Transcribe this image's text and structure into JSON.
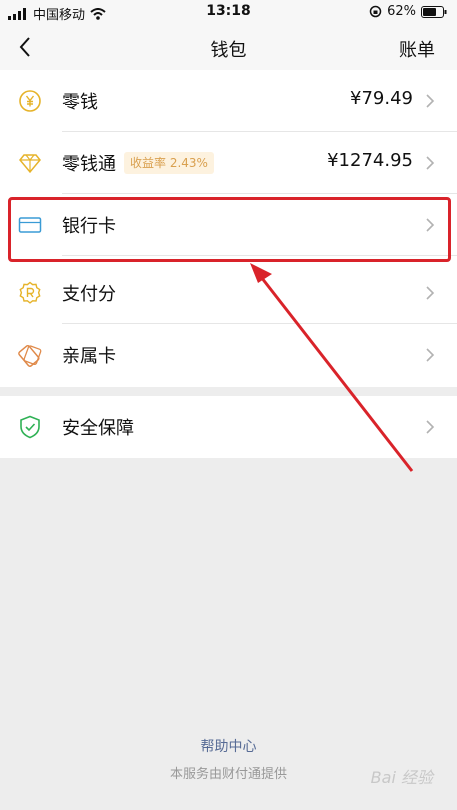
{
  "status_bar": {
    "carrier": "中国移动",
    "time": "13:18",
    "battery": "62%"
  },
  "nav": {
    "title": "钱包",
    "action": "账单"
  },
  "wallet_items": [
    {
      "label": "零钱",
      "value": "¥79.49",
      "icon": "coin-icon",
      "color": "#e6b32a"
    },
    {
      "label": "零钱通",
      "badge": "收益率 2.43%",
      "value": "¥1274.95",
      "icon": "diamond-icon",
      "color": "#e6b32a"
    },
    {
      "label": "银行卡",
      "icon": "bank-card-icon",
      "color": "#3a9bd5"
    },
    {
      "label": "支付分",
      "icon": "credit-score-icon",
      "color": "#e6b32a"
    },
    {
      "label": "亲属卡",
      "icon": "family-card-icon",
      "color": "#e08a4a"
    }
  ],
  "security": {
    "label": "安全保障",
    "icon": "shield-icon",
    "color": "#2fb155"
  },
  "footer": {
    "help_link": "帮助中心",
    "provider_note": "本服务由财付通提供"
  },
  "watermark": "Bai 经验"
}
